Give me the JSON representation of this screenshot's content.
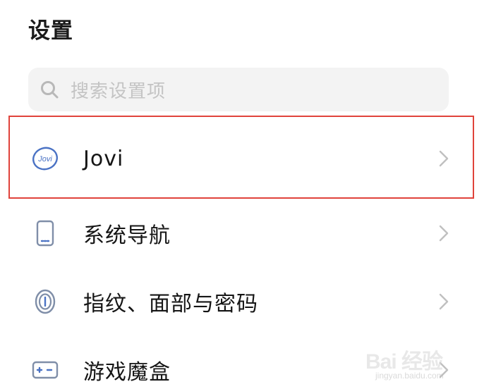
{
  "header": {
    "title": "设置"
  },
  "search": {
    "icon": "search-icon",
    "placeholder": "搜索设置项"
  },
  "settings": {
    "items": [
      {
        "label": "Jovi",
        "icon": "jovi-icon",
        "icon_text": "Jovi",
        "highlighted": true
      },
      {
        "label": "系统导航",
        "icon": "phone-navigation-icon"
      },
      {
        "label": "指纹、面部与密码",
        "icon": "fingerprint-icon"
      },
      {
        "label": "游戏魔盒",
        "icon": "game-box-icon"
      }
    ]
  },
  "watermark": {
    "logo": "Bai 经验",
    "url": "jingyan.baidu.com"
  },
  "colors": {
    "highlight": "#e0433b",
    "icon_blue": "#4a72c4",
    "icon_gray": "#7f8ea8",
    "chevron": "#c0c0c0",
    "search_bg": "#f3f3f3"
  }
}
